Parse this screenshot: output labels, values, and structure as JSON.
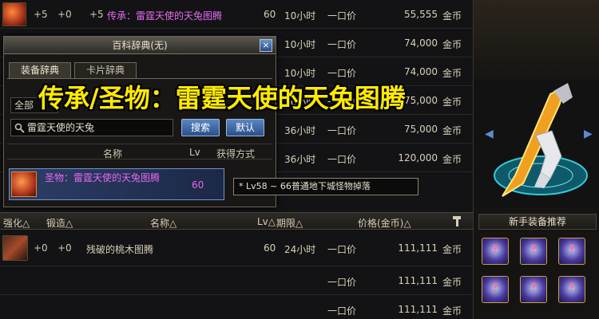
{
  "caption": "传承/圣物：雷霆天使的天兔图腾",
  "auction_rows": [
    {
      "plus1": "+5",
      "plus2": "+0",
      "plus3": "+5",
      "name": "传承：雷霆天使的天兔图腾",
      "lv": "60",
      "time": "10小时",
      "once": "一口价",
      "price": "55,555",
      "unit": "金币"
    },
    {
      "plus1": "",
      "plus2": "",
      "plus3": "",
      "name": "",
      "lv": "",
      "time": "10小时",
      "once": "一口价",
      "price": "74,000",
      "unit": "金币"
    },
    {
      "plus1": "",
      "plus2": "",
      "plus3": "",
      "name": "",
      "lv": "",
      "time": "10小时",
      "once": "一口价",
      "price": "74,000",
      "unit": "金币"
    },
    {
      "plus1": "",
      "plus2": "",
      "plus3": "",
      "name": "",
      "lv": "",
      "time": "36小时",
      "once": "一口价",
      "price": "75,000",
      "unit": "金币"
    },
    {
      "plus1": "",
      "plus2": "",
      "plus3": "",
      "name": "",
      "lv": "",
      "time": "36小时",
      "once": "一口价",
      "price": "75,000",
      "unit": "金币"
    },
    {
      "plus1": "",
      "plus2": "",
      "plus3": "",
      "name": "",
      "lv": "",
      "time": "36小时",
      "once": "一口价",
      "price": "120,000",
      "unit": "金币"
    }
  ],
  "column_headers": {
    "strengthen": "强化△",
    "forge": "锻造△",
    "name": "名称△",
    "lv": "Lv△",
    "period": "期限△",
    "price": "价格(金币)△"
  },
  "own_row": {
    "plus1": "+0",
    "plus2": "+0",
    "name": "残破的桃木图腾",
    "lv": "60",
    "time": "24小时",
    "once": "一口价",
    "price": "111,111",
    "unit": "金币"
  },
  "lower_rows": [
    {
      "once": "一口价",
      "price": "111,111",
      "unit": "金币"
    },
    {
      "once": "一口价",
      "price": "111,111",
      "unit": "金币"
    }
  ],
  "encyclopedia": {
    "title": "百科辞典(无)",
    "close": "×",
    "tabs": [
      "装备辞典",
      "卡片辞典"
    ],
    "filter": "全部",
    "search_value": "雷霆天使的天兔",
    "search_button": "搜索",
    "default_button": "默认",
    "list_headers": {
      "name": "名称",
      "lv": "Lv",
      "source": "获得方式"
    },
    "result": {
      "name": "圣物：雷霆天使的天兔图腾",
      "lv": "60"
    },
    "tooltip": "* Lv58 ~ 66普通地下城怪物掉落"
  },
  "right_panel": {
    "recommend_title": "新手装备推荐",
    "arrow_left": "◀",
    "arrow_right": "▶",
    "slots": [
      "?",
      "?",
      "?",
      "?",
      "?",
      "?"
    ]
  }
}
